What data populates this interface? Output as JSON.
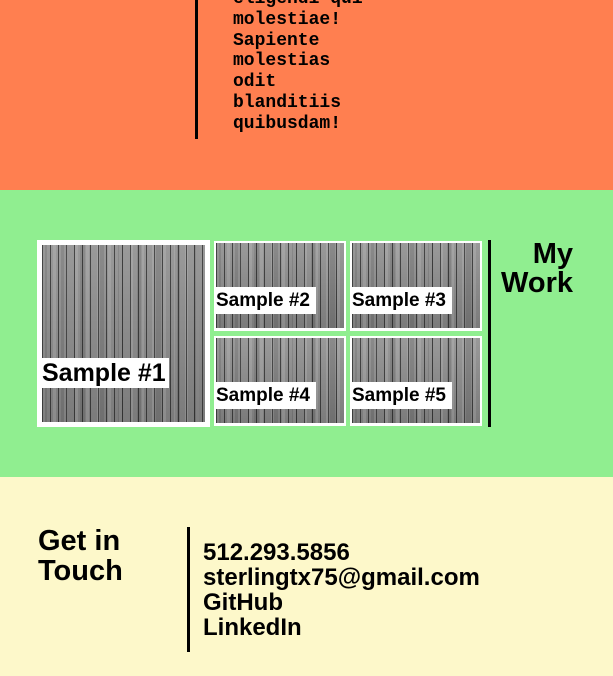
{
  "about": {
    "lines": [
      "eligendi qui",
      "molestiae!",
      "Sapiente",
      "molestias",
      "odit",
      "blanditiis",
      "quibusdam!"
    ]
  },
  "work": {
    "title_line1": "My",
    "title_line2": "Work",
    "samples": [
      "Sample #1",
      "Sample #2",
      "Sample #3",
      "Sample #4",
      "Sample #5"
    ]
  },
  "contact": {
    "title_line1": "Get in",
    "title_line2": "Touch",
    "phone": "512.293.5856",
    "email": "sterlingtx75@gmail.com",
    "github": "GitHub",
    "linkedin": "LinkedIn"
  },
  "colors": {
    "about_bg": "#ff7f50",
    "work_bg": "#90ee90",
    "contact_bg": "#fdf8ca"
  }
}
